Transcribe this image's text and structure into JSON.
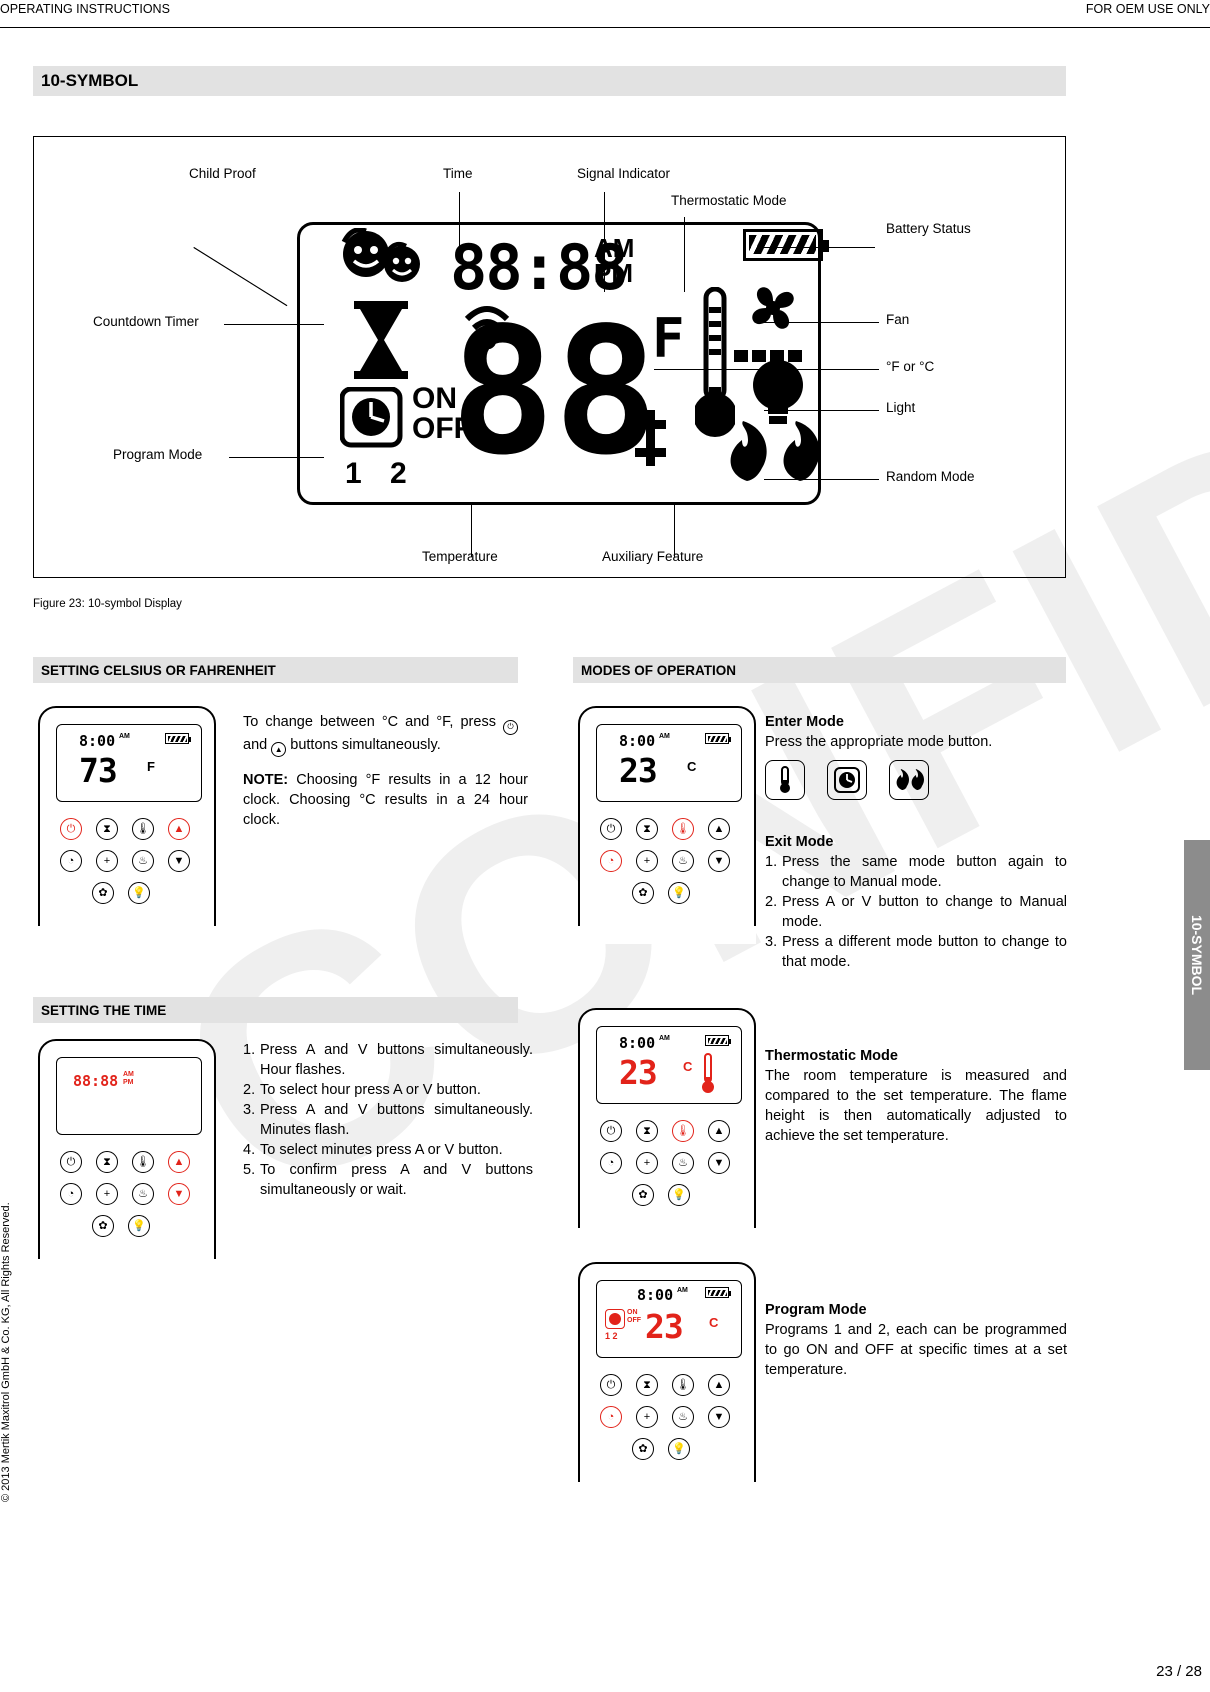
{
  "header": {
    "left": "OPERATING INSTRUCTIONS",
    "right": "FOR OEM USE ONLY"
  },
  "section_title": "10-SYMBOL",
  "side_tab": "10-SYMBOL",
  "figure": {
    "caption": "Figure 23: 10-symbol Display",
    "labels": {
      "child_proof": "Child Proof",
      "time": "Time",
      "signal_indicator": "Signal Indicator",
      "thermostatic_mode": "Thermostatic Mode",
      "battery_status": "Battery Status",
      "countdown_timer": "Countdown Timer",
      "fan": "Fan",
      "degrees": "°F or °C",
      "light": "Light",
      "program_mode": "Program Mode",
      "random_mode": "Random Mode",
      "temperature": "Temperature",
      "auxiliary_feature": "Auxiliary Feature"
    },
    "lcd": {
      "clock": "88:88",
      "am": "AM",
      "pm": "PM",
      "big_digits": "88",
      "on": "ON",
      "off": "OFF",
      "program_numbers": "1 2",
      "unit": "F"
    }
  },
  "celsius": {
    "bar": "SETTING CELSIUS OR FAHRENHEIT",
    "para1_a": "To change between °C and °F, press",
    "para1_b": "and",
    "para1_c": "buttons simultaneously.",
    "note_label": "NOTE:",
    "note_text": "Choosing °F results in a 12 hour clock. Choosing °C results in a 24 hour clock.",
    "remote": {
      "time": "8:00",
      "ampm": "AM",
      "value": "73",
      "unit": "F"
    }
  },
  "time": {
    "bar": "SETTING THE TIME",
    "steps": [
      "Press  A  and  V  buttons simultaneously. Hour flashes.",
      "To select hour press  A  or  V  button.",
      "Press  A  and  V  buttons simultaneously. Minutes flash.",
      "To select minutes press  A  or  V  button.",
      "To confirm press  A  and  V  buttons simultaneously or wait."
    ],
    "remote": {
      "time": "88:88",
      "am": "AM",
      "pm": "PM"
    }
  },
  "modes": {
    "bar": "MODES OF OPERATION",
    "enter": {
      "title": "Enter Mode",
      "text": "Press the appropriate mode button."
    },
    "exit": {
      "title": "Exit Mode",
      "steps": [
        "Press the same mode button again to change to Manual mode.",
        "Press  A  or  V  button to change to Manual mode.",
        "Press a different mode button to change to that mode."
      ]
    },
    "thermostatic": {
      "title": "Thermostatic Mode",
      "text": "The room temperature is measured and compared to the set temperature. The flame height is then automatically adjusted to achieve the set temperature."
    },
    "program": {
      "title": "Program Mode",
      "text": "Programs 1 and 2, each can be programmed to go ON and OFF at specific times at a set temperature."
    },
    "remote_enter": {
      "time": "8:00",
      "ampm": "AM",
      "value": "23",
      "unit": "C"
    },
    "remote_thermo": {
      "time": "8:00",
      "ampm": "AM",
      "value": "23",
      "unit": "C"
    },
    "remote_program": {
      "time": "8:00",
      "ampm": "AM",
      "value": "23",
      "unit": "C",
      "on": "ON",
      "off": "OFF",
      "numbers": "1 2"
    }
  },
  "footer": {
    "page": "23 / 28",
    "copyright": "© 2013 Mertik Maxitrol GmbH & Co. KG, All Rights Reserved."
  },
  "watermark": "CONFIDENTIAL"
}
